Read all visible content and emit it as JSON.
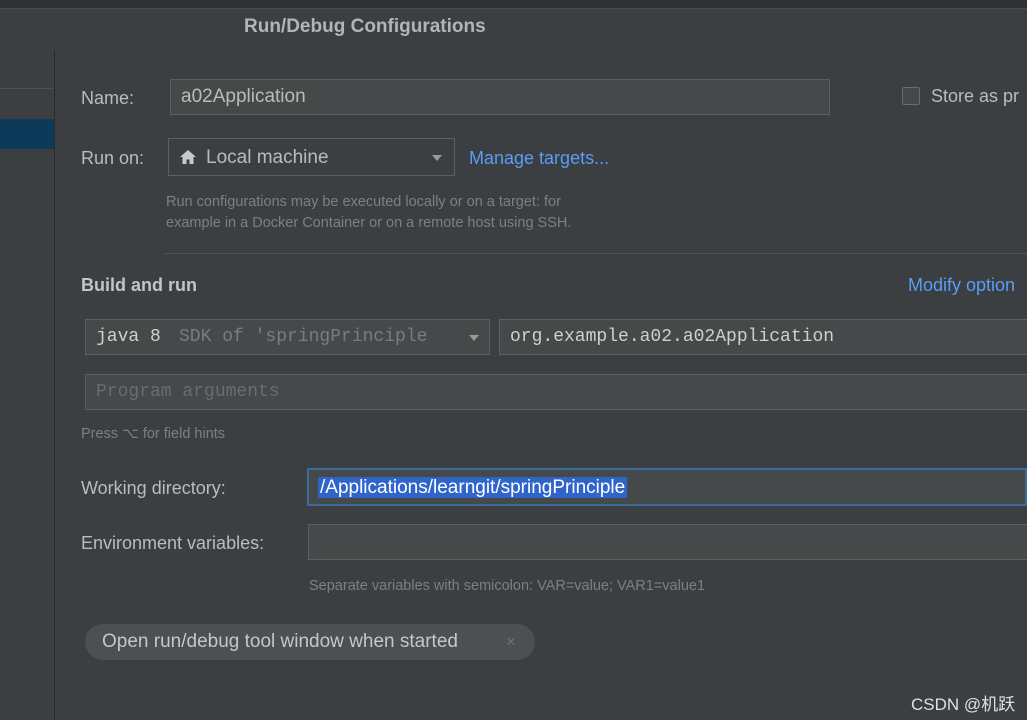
{
  "dialog": {
    "title": "Run/Debug Configurations"
  },
  "name_row": {
    "label": "Name:",
    "value": "a02Application",
    "store_label": "Store as pr"
  },
  "run_on": {
    "label": "Run on:",
    "value": "Local machine",
    "home_icon": "home-icon",
    "manage_link": "Manage targets...",
    "hint_line1": "Run configurations may be executed locally or on a target: for",
    "hint_line2": "example in a Docker Container or on a remote host using SSH."
  },
  "build": {
    "heading": "Build and run",
    "modify_link": "Modify option",
    "sdk_primary": "java 8",
    "sdk_secondary": "SDK of 'springPrinciple",
    "main_class": "org.example.a02.a02Application",
    "program_args_placeholder": "Program arguments",
    "field_hint": "Press ⌥ for field hints"
  },
  "working_dir": {
    "label": "Working directory:",
    "value": "/Applications/learngit/springPrinciple"
  },
  "env": {
    "label": "Environment variables:",
    "value": "",
    "hint": "Separate variables with semicolon: VAR=value; VAR1=value1"
  },
  "tool_window_chip": {
    "label": "Open run/debug tool window when started",
    "close": "×"
  },
  "watermark": "CSDN @机跃",
  "colors": {
    "background": "#3c3f41",
    "link": "#589df6",
    "selection": "#2f65ca",
    "tree_selection": "#0d3a58"
  }
}
